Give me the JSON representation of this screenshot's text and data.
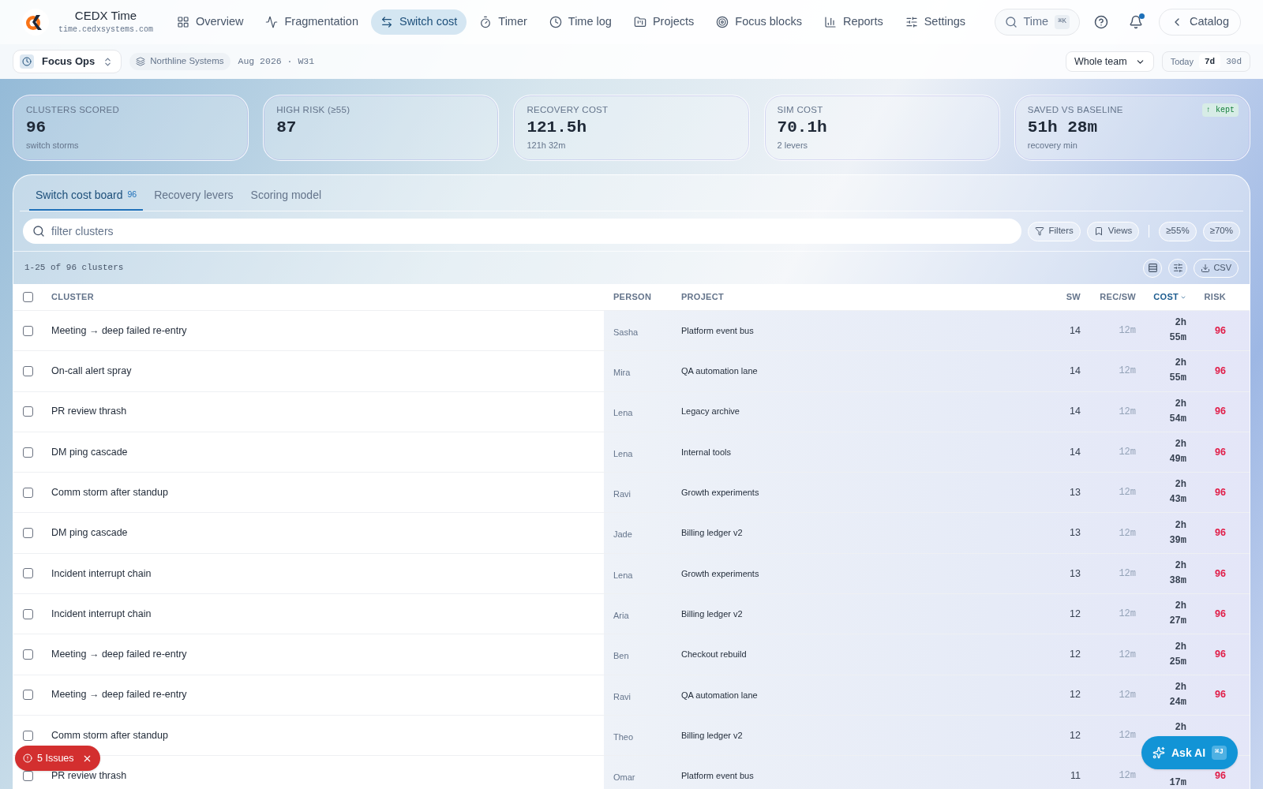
{
  "brand": {
    "name": "CEDX Time",
    "domain": "time.cedxsystems.com"
  },
  "nav": [
    {
      "label": "Overview",
      "selected": false
    },
    {
      "label": "Fragmentation",
      "selected": false
    },
    {
      "label": "Switch cost",
      "selected": true
    },
    {
      "label": "Timer",
      "selected": false
    },
    {
      "label": "Time log",
      "selected": false
    },
    {
      "label": "Projects",
      "selected": false
    },
    {
      "label": "Focus blocks",
      "selected": false
    },
    {
      "label": "Reports",
      "selected": false
    },
    {
      "label": "Settings",
      "selected": false
    }
  ],
  "search": {
    "label": "Time",
    "shortcut": "⌘K"
  },
  "notifications": {
    "unread": true
  },
  "back_button": "Catalog",
  "workspace": "Focus Ops",
  "org": "Northline Systems",
  "period": "Aug 2026 · W31",
  "scope": "Whole team",
  "ranges": [
    {
      "label": "Today",
      "selected": false
    },
    {
      "label": "7d",
      "selected": true
    },
    {
      "label": "30d",
      "selected": false
    }
  ],
  "stats": [
    {
      "label": "CLUSTERS SCORED",
      "value": "96",
      "note": "switch storms"
    },
    {
      "label": "HIGH RISK (≥55)",
      "value": "87"
    },
    {
      "label": "RECOVERY COST",
      "value": "121.5h",
      "note": "121h 32m"
    },
    {
      "label": "SIM COST",
      "value": "70.1h",
      "note": "2 levers"
    },
    {
      "label": "SAVED VS BASELINE",
      "value": "51h 28m",
      "note": "recovery min",
      "badge": "↑ kept"
    }
  ],
  "tabs": [
    {
      "label": "Switch cost board",
      "count": "96",
      "selected": true
    },
    {
      "label": "Recovery levers",
      "selected": false
    },
    {
      "label": "Scoring model",
      "selected": false
    }
  ],
  "filter": {
    "placeholder": "filter clusters"
  },
  "filter_buttons": [
    "Filters",
    "Views"
  ],
  "thresholds": [
    "≥55%",
    "≥70%"
  ],
  "range_text": "1-25 of 96 clusters",
  "csv": "CSV",
  "table": {
    "select_all": {
      "checked": false
    },
    "columns": [
      {
        "label": "CLUSTER",
        "sorted": false
      },
      {
        "label": "PERSON",
        "sorted": false
      },
      {
        "label": "PROJECT",
        "sorted": false
      },
      {
        "label": "SW",
        "sorted": false
      },
      {
        "label": "REC/SW",
        "sorted": false
      },
      {
        "label": "COST",
        "sorted": true
      },
      {
        "label": "RISK",
        "sorted": false
      }
    ],
    "rows": [
      {
        "checked": false,
        "cluster": "Meeting → deep failed re-entry",
        "person": "Sasha",
        "project": "Platform event bus",
        "sw": "14",
        "rec_sw": "12m",
        "cost": {
          "hours": "2h",
          "minutes": "55m"
        },
        "risk": "96"
      },
      {
        "checked": false,
        "cluster": "On-call alert spray",
        "person": "Mira",
        "project": "QA automation lane",
        "sw": "14",
        "rec_sw": "12m",
        "cost": {
          "hours": "2h",
          "minutes": "55m"
        },
        "risk": "96"
      },
      {
        "checked": false,
        "cluster": "PR review thrash",
        "person": "Lena",
        "project": "Legacy archive",
        "sw": "14",
        "rec_sw": "12m",
        "cost": {
          "hours": "2h",
          "minutes": "54m"
        },
        "risk": "96"
      },
      {
        "checked": false,
        "cluster": "DM ping cascade",
        "person": "Lena",
        "project": "Internal tools",
        "sw": "14",
        "rec_sw": "12m",
        "cost": {
          "hours": "2h",
          "minutes": "49m"
        },
        "risk": "96"
      },
      {
        "checked": false,
        "cluster": "Comm storm after standup",
        "person": "Ravi",
        "project": "Growth experiments",
        "sw": "13",
        "rec_sw": "12m",
        "cost": {
          "hours": "2h",
          "minutes": "43m"
        },
        "risk": "96"
      },
      {
        "checked": false,
        "cluster": "DM ping cascade",
        "person": "Jade",
        "project": "Billing ledger v2",
        "sw": "13",
        "rec_sw": "12m",
        "cost": {
          "hours": "2h",
          "minutes": "39m"
        },
        "risk": "96"
      },
      {
        "checked": false,
        "cluster": "Incident interrupt chain",
        "person": "Lena",
        "project": "Growth experiments",
        "sw": "13",
        "rec_sw": "12m",
        "cost": {
          "hours": "2h",
          "minutes": "38m"
        },
        "risk": "96"
      },
      {
        "checked": false,
        "cluster": "Incident interrupt chain",
        "person": "Aria",
        "project": "Billing ledger v2",
        "sw": "12",
        "rec_sw": "12m",
        "cost": {
          "hours": "2h",
          "minutes": "27m"
        },
        "risk": "96"
      },
      {
        "checked": false,
        "cluster": "Meeting → deep failed re-entry",
        "person": "Ben",
        "project": "Checkout rebuild",
        "sw": "12",
        "rec_sw": "12m",
        "cost": {
          "hours": "2h",
          "minutes": "25m"
        },
        "risk": "96"
      },
      {
        "checked": false,
        "cluster": "Meeting → deep failed re-entry",
        "person": "Ravi",
        "project": "QA automation lane",
        "sw": "12",
        "rec_sw": "12m",
        "cost": {
          "hours": "2h",
          "minutes": "24m"
        },
        "risk": "96"
      },
      {
        "checked": false,
        "cluster": "Comm storm after standup",
        "person": "Theo",
        "project": "Billing ledger v2",
        "sw": "12",
        "rec_sw": "12m",
        "cost": {
          "hours": "2h"
        }
      },
      {
        "checked": false,
        "cluster": "PR review thrash",
        "person": "Omar",
        "project": "Platform event bus",
        "sw": "11",
        "rec_sw": "12m",
        "cost": {
          "minutes": "17m"
        },
        "risk": "96"
      }
    ]
  },
  "issues": "5 Issues",
  "ask_ai": {
    "label": "Ask AI",
    "shortcut": "⌘J"
  }
}
